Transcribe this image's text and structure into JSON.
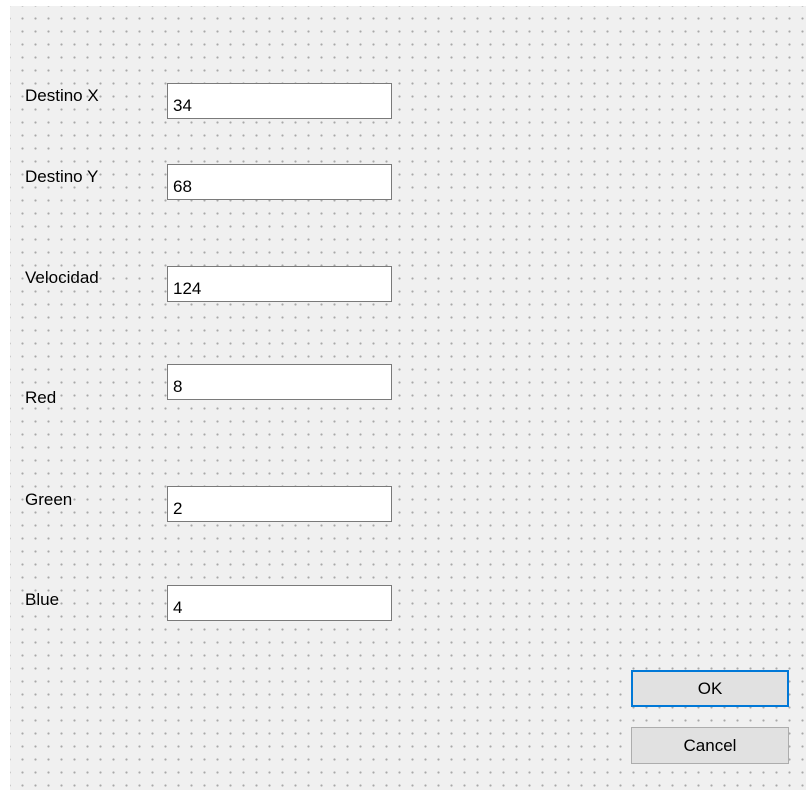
{
  "dialog": {
    "fields": [
      {
        "label": "Destino X",
        "value": "34"
      },
      {
        "label": "Destino Y",
        "value": "68"
      },
      {
        "label": "Velocidad",
        "value": "124"
      },
      {
        "label": "Red",
        "value": "8"
      },
      {
        "label": "Green",
        "value": "2"
      },
      {
        "label": "Blue",
        "value": "4"
      }
    ],
    "buttons": {
      "ok_label": "OK",
      "cancel_label": "Cancel"
    }
  },
  "colors": {
    "background": "#f0f0f0",
    "grid_dots": "#a8a8a8",
    "field_border": "#7a7a7a",
    "button_face": "#e1e1e1",
    "default_button_border": "#0078d7"
  }
}
